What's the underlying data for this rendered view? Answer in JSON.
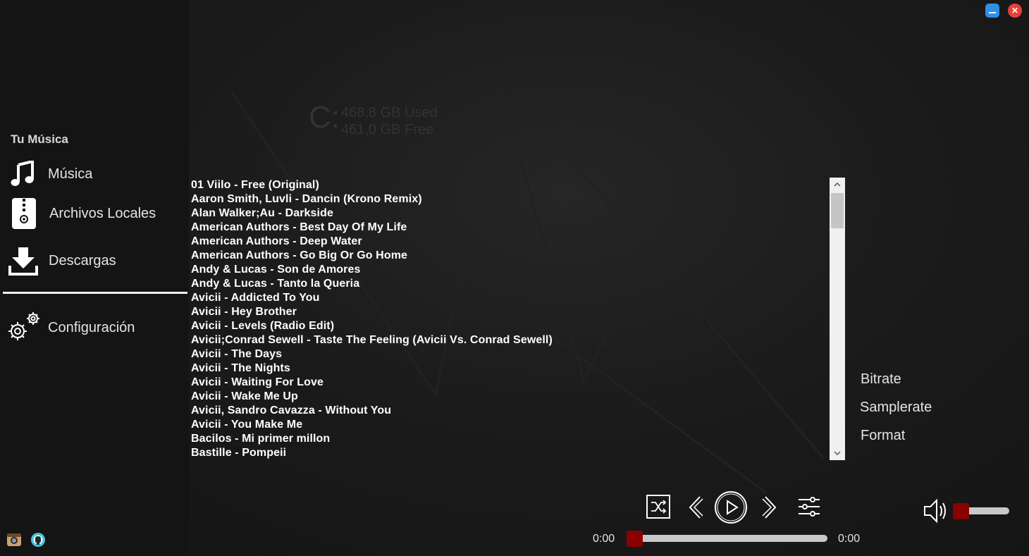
{
  "window": {
    "minimize_label": "–",
    "close_label": "✕"
  },
  "sidebar": {
    "title": "Tu Música",
    "items": [
      {
        "label": "Música",
        "icon": "music-note-icon"
      },
      {
        "label": "Archivos Locales",
        "icon": "zip-file-icon"
      },
      {
        "label": "Descargas",
        "icon": "download-icon"
      },
      {
        "label": "Configuración",
        "icon": "gears-icon"
      }
    ],
    "social": [
      {
        "icon": "instagram-icon"
      },
      {
        "icon": "github-icon"
      }
    ]
  },
  "drive": {
    "letter": "C:",
    "used": "468,8 GB Used",
    "free": "461,0 GB Free"
  },
  "songs": [
    "01 Viilo - Free (Original)",
    "Aaron Smith, Luvli - Dancin (Krono Remix)",
    "Alan Walker;Au - Darkside",
    "American Authors - Best Day Of My Life",
    "American Authors - Deep Water",
    "American Authors - Go Big Or Go Home",
    "Andy & Lucas - Son de Amores",
    "Andy & Lucas - Tanto la Queria",
    "Avicii - Addicted To You",
    "Avicii - Hey Brother",
    "Avicii - Levels (Radio Edit)",
    "Avicii;Conrad Sewell - Taste The Feeling (Avicii Vs. Conrad Sewell)",
    "Avicii - The Days",
    "Avicii - The Nights",
    "Avicii - Waiting For Love",
    "Avicii - Wake Me Up",
    "Avicii, Sandro Cavazza - Without You",
    "Avicii - You Make Me",
    "Bacilos - Mi primer millon",
    "Bastille - Pompeii"
  ],
  "scroll": {
    "up": "˄",
    "down": "˅"
  },
  "track_info": {
    "bitrate": "Bitrate",
    "samplerate": "Samplerate",
    "format": "Format"
  },
  "player": {
    "current_time": "0:00",
    "total_time": "0:00",
    "progress": 0,
    "volume": 0,
    "accent_color": "#8b0000"
  },
  "colors": {
    "background": "#1b1b1b",
    "sidebar": "#141414",
    "minimize": "#2f8fe6",
    "close": "#e6403a"
  }
}
